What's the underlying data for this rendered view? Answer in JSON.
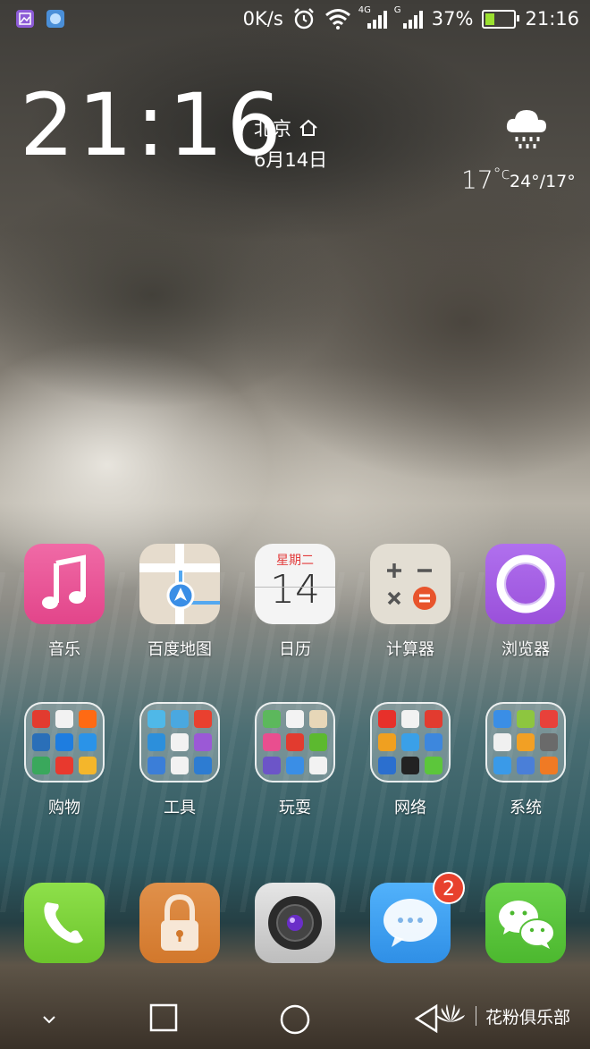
{
  "status_bar": {
    "speed": "0K/s",
    "net_4g": "4G",
    "net_g": "G",
    "battery": "37%",
    "battery_level": 0.37,
    "time": "21:16",
    "icons": [
      "gallery-notification-icon",
      "app-notification-icon",
      "alarm-icon",
      "wifi-icon",
      "signal-4g-icon",
      "signal-g-icon",
      "battery-icon"
    ]
  },
  "clock_widget": {
    "time": "21:16",
    "city": "北京",
    "date": "6月14日"
  },
  "weather": {
    "temperature": "17",
    "unit": "°c",
    "range": "24°/17°",
    "icon": "rain-cloud-icon"
  },
  "apps": {
    "row1": [
      {
        "label": "音乐",
        "icon": "music-icon",
        "color": "#e94e8f"
      },
      {
        "label": "百度地图",
        "icon": "map-icon",
        "color": "#e7ddcf"
      },
      {
        "label": "日历",
        "icon": "calendar-icon",
        "color": "#f2f2f2",
        "weekday": "星期二",
        "day": "14"
      },
      {
        "label": "计算器",
        "icon": "calculator-icon",
        "color": "#e2ddd2"
      },
      {
        "label": "浏览器",
        "icon": "browser-icon",
        "color": "#a45fe0"
      }
    ],
    "row2": [
      {
        "label": "购物",
        "icon": "shopping-folder-icon"
      },
      {
        "label": "工具",
        "icon": "tools-folder-icon"
      },
      {
        "label": "玩耍",
        "icon": "play-folder-icon"
      },
      {
        "label": "网络",
        "icon": "network-folder-icon"
      },
      {
        "label": "系统",
        "icon": "system-folder-icon"
      }
    ]
  },
  "dock": [
    {
      "name": "phone-icon",
      "color": "#7ed03b"
    },
    {
      "name": "lock-icon",
      "color": "#dd8a3b"
    },
    {
      "name": "camera-icon",
      "color": "#cfcfcf"
    },
    {
      "name": "messages-icon",
      "color": "#3a9ef0",
      "badge": "2"
    },
    {
      "name": "wechat-icon",
      "color": "#5cc63b"
    }
  ],
  "nav": {
    "brand_text": "花粉俱乐部",
    "brand_logo": "HUAWEI",
    "buttons": [
      "chevron-down-icon",
      "recents-icon",
      "home-icon",
      "back-icon"
    ]
  }
}
